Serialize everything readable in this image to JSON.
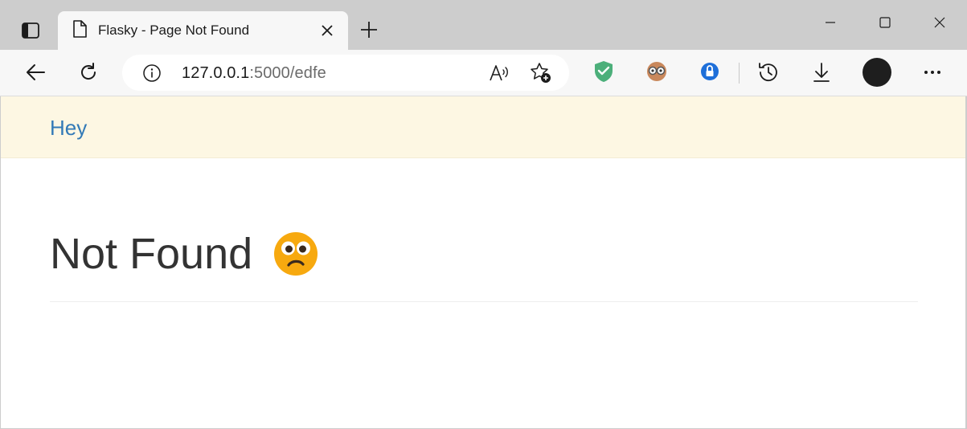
{
  "browser": {
    "tab": {
      "title": "Flasky - Page Not Found"
    },
    "address": {
      "host": "127.0.0.1",
      "rest": ":5000/edfe"
    },
    "icons": {
      "tab_actions": "tab-actions-icon",
      "page": "document-icon",
      "close": "close-icon",
      "new_tab": "plus-icon",
      "minimize": "minimize-icon",
      "maximize": "maximize-icon",
      "window_close": "close-icon",
      "back": "back-arrow-icon",
      "refresh": "refresh-icon",
      "site_info": "info-icon",
      "read_aloud": "read-aloud-icon",
      "favorites": "add-favorite-icon",
      "extensions": [
        "adguard-shield-icon",
        "glasses-extension-icon",
        "password-manager-icon"
      ],
      "history": "history-icon",
      "downloads": "download-icon",
      "profile": "profile-avatar",
      "menu": "more-icon"
    }
  },
  "page": {
    "navbar": {
      "brand": "Hey",
      "background": "#fdf7e3",
      "brand_color": "#337ab7"
    },
    "heading": "Not Found",
    "emoji": "confused-face-emoji"
  }
}
